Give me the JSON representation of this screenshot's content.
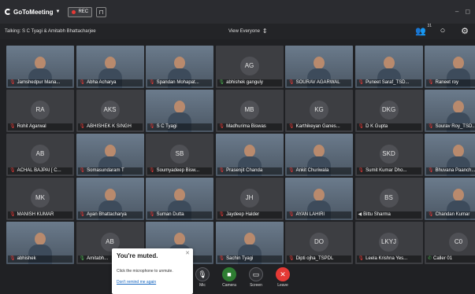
{
  "app": {
    "logo_text": "GoToMeeting",
    "rec_label": "REC"
  },
  "infobar": {
    "talking": "Talking: S C Tyagi & Amitabh Bhattacharjee",
    "view": "View Everyone",
    "attendee_count": "31"
  },
  "participants": [
    {
      "name": "Jamshedpur Mana...",
      "initials": "",
      "video": true,
      "audio": "muted"
    },
    {
      "name": "Abha Acharya",
      "initials": "",
      "video": true,
      "audio": "muted"
    },
    {
      "name": "Spandan Mohapat...",
      "initials": "",
      "video": true,
      "audio": "muted"
    },
    {
      "name": "abhishek ganguly",
      "initials": "AG",
      "video": false,
      "audio": "on"
    },
    {
      "name": "SOURAV AGARWAL",
      "initials": "",
      "video": true,
      "audio": "muted"
    },
    {
      "name": "Puneet Saraf_TSD...",
      "initials": "",
      "video": true,
      "audio": "muted"
    },
    {
      "name": "Raneet roy",
      "initials": "",
      "video": true,
      "audio": "muted"
    },
    {
      "name": "Rohit Agarwal",
      "initials": "RA",
      "video": false,
      "audio": "muted"
    },
    {
      "name": "ABHISHEK K SINGH",
      "initials": "AKS",
      "video": false,
      "audio": "muted"
    },
    {
      "name": "S C Tyagi",
      "initials": "",
      "video": true,
      "audio": "muted"
    },
    {
      "name": "Madhurima Biswas",
      "initials": "MB",
      "video": false,
      "audio": "muted"
    },
    {
      "name": "Karthikeyan Ganes...",
      "initials": "KG",
      "video": false,
      "audio": "muted"
    },
    {
      "name": "D K Gupta",
      "initials": "DKG",
      "video": false,
      "audio": "muted"
    },
    {
      "name": "Sourav Roy_TSD...",
      "initials": "",
      "video": true,
      "audio": "muted"
    },
    {
      "name": "ACHAL BAJPAI [ C...",
      "initials": "AB",
      "video": false,
      "audio": "muted"
    },
    {
      "name": "Somasundaram T",
      "initials": "",
      "video": true,
      "audio": "muted"
    },
    {
      "name": "Soumyadeep Bisw...",
      "initials": "SB",
      "video": false,
      "audio": "muted"
    },
    {
      "name": "Prasenjit Chanda",
      "initials": "",
      "video": true,
      "audio": "muted"
    },
    {
      "name": "Ankit Churiwala",
      "initials": "",
      "video": true,
      "audio": "muted"
    },
    {
      "name": "Sumit Kumar Dho...",
      "initials": "SKD",
      "video": false,
      "audio": "muted"
    },
    {
      "name": "Bhuvana Paanch...",
      "initials": "",
      "video": true,
      "audio": "muted"
    },
    {
      "name": "MANISH KUMAR",
      "initials": "MK",
      "video": false,
      "audio": "muted"
    },
    {
      "name": "Ayan Bhattacharya",
      "initials": "",
      "video": true,
      "audio": "muted"
    },
    {
      "name": "Suman Dutta",
      "initials": "",
      "video": true,
      "audio": "muted"
    },
    {
      "name": "Jaydeep Halder",
      "initials": "JH",
      "video": false,
      "audio": "muted"
    },
    {
      "name": "AYAN LAHIRI",
      "initials": "",
      "video": true,
      "audio": "muted"
    },
    {
      "name": "Bittu Sharma",
      "initials": "BS",
      "video": false,
      "audio": "speaker"
    },
    {
      "name": "Chandan Kumar",
      "initials": "",
      "video": true,
      "audio": "muted"
    },
    {
      "name": "abhishek",
      "initials": "",
      "video": true,
      "audio": "muted"
    },
    {
      "name": "Amitabh...",
      "initials": "AB",
      "video": false,
      "audio": "on"
    },
    {
      "name": "...ar",
      "initials": "",
      "video": true,
      "audio": "muted"
    },
    {
      "name": "Sachin Tyagi",
      "initials": "",
      "video": true,
      "audio": "muted"
    },
    {
      "name": "Dipti ojha_TSPDL",
      "initials": "DO",
      "video": false,
      "audio": "muted"
    },
    {
      "name": "Leela Krishna Yes...",
      "initials": "LKYJ",
      "video": false,
      "audio": "muted"
    },
    {
      "name": "Caller 01",
      "initials": "C0",
      "video": false,
      "audio": "phone"
    }
  ],
  "toolbar": {
    "mic": "Mic",
    "camera": "Camera",
    "screen": "Screen",
    "leave": "Leave"
  },
  "popup": {
    "title": "You're muted.",
    "message": "Click the microphone to unmute.",
    "link": "Don't remind me again"
  },
  "colors": {
    "muted": "#e53935",
    "camera_on": "#2e7d32",
    "leave": "#e53935"
  }
}
